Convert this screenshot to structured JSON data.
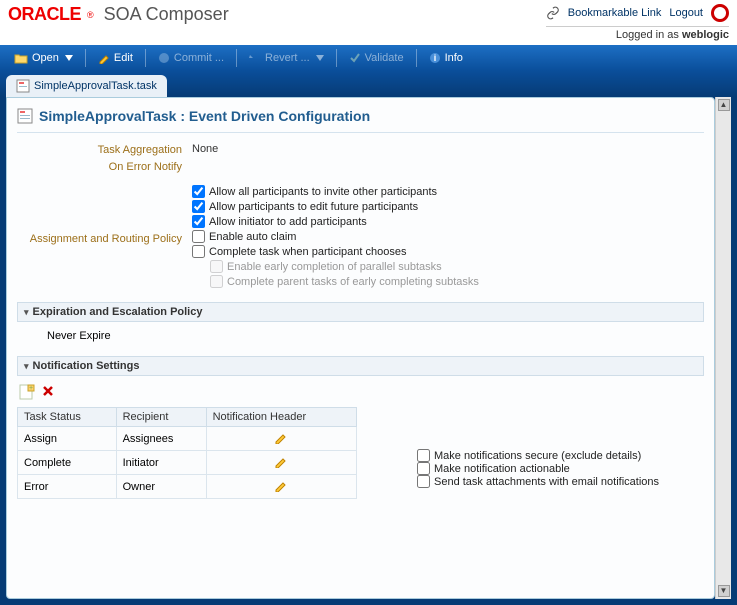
{
  "header": {
    "logo_brand": "ORACLE",
    "logo_product": "SOA Composer",
    "bookmarkable": "Bookmarkable Link",
    "logout": "Logout",
    "logged_in_prefix": "Logged in as ",
    "logged_in_user": "weblogic"
  },
  "toolbar": {
    "open": "Open",
    "edit": "Edit",
    "commit": "Commit ...",
    "revert": "Revert ...",
    "validate": "Validate",
    "info": "Info"
  },
  "tab": {
    "filename": "SimpleApprovalTask.task"
  },
  "page": {
    "title": "SimpleApprovalTask : Event Driven Configuration"
  },
  "aggregation": {
    "label": "Task Aggregation",
    "value": "None"
  },
  "error_notify": {
    "label": "On Error Notify"
  },
  "routing": {
    "label": "Assignment and Routing Policy",
    "cb1": {
      "checked": true,
      "label": "Allow all participants to invite other participants"
    },
    "cb2": {
      "checked": true,
      "label": "Allow participants to edit future participants"
    },
    "cb3": {
      "checked": true,
      "label": "Allow initiator to add participants"
    },
    "cb4": {
      "checked": false,
      "label": "Enable auto claim"
    },
    "cb5": {
      "checked": false,
      "label": "Complete task when participant chooses"
    },
    "cb6": {
      "checked": false,
      "label": "Enable early completion of parallel subtasks"
    },
    "cb7": {
      "checked": false,
      "label": "Complete parent tasks of early completing subtasks"
    }
  },
  "expiration": {
    "title": "Expiration and Escalation Policy",
    "value": "Never Expire"
  },
  "notification": {
    "title": "Notification Settings",
    "columns": {
      "c1": "Task Status",
      "c2": "Recipient",
      "c3": "Notification Header"
    },
    "rows": [
      {
        "status": "Assign",
        "recipient": "Assignees"
      },
      {
        "status": "Complete",
        "recipient": "Initiator"
      },
      {
        "status": "Error",
        "recipient": "Owner"
      }
    ],
    "right_cb1": {
      "checked": false,
      "label": "Make notifications secure (exclude details)"
    },
    "right_cb2": {
      "checked": false,
      "label": "Make notification actionable"
    },
    "right_cb3": {
      "checked": false,
      "label": "Send task attachments with email notifications"
    }
  }
}
